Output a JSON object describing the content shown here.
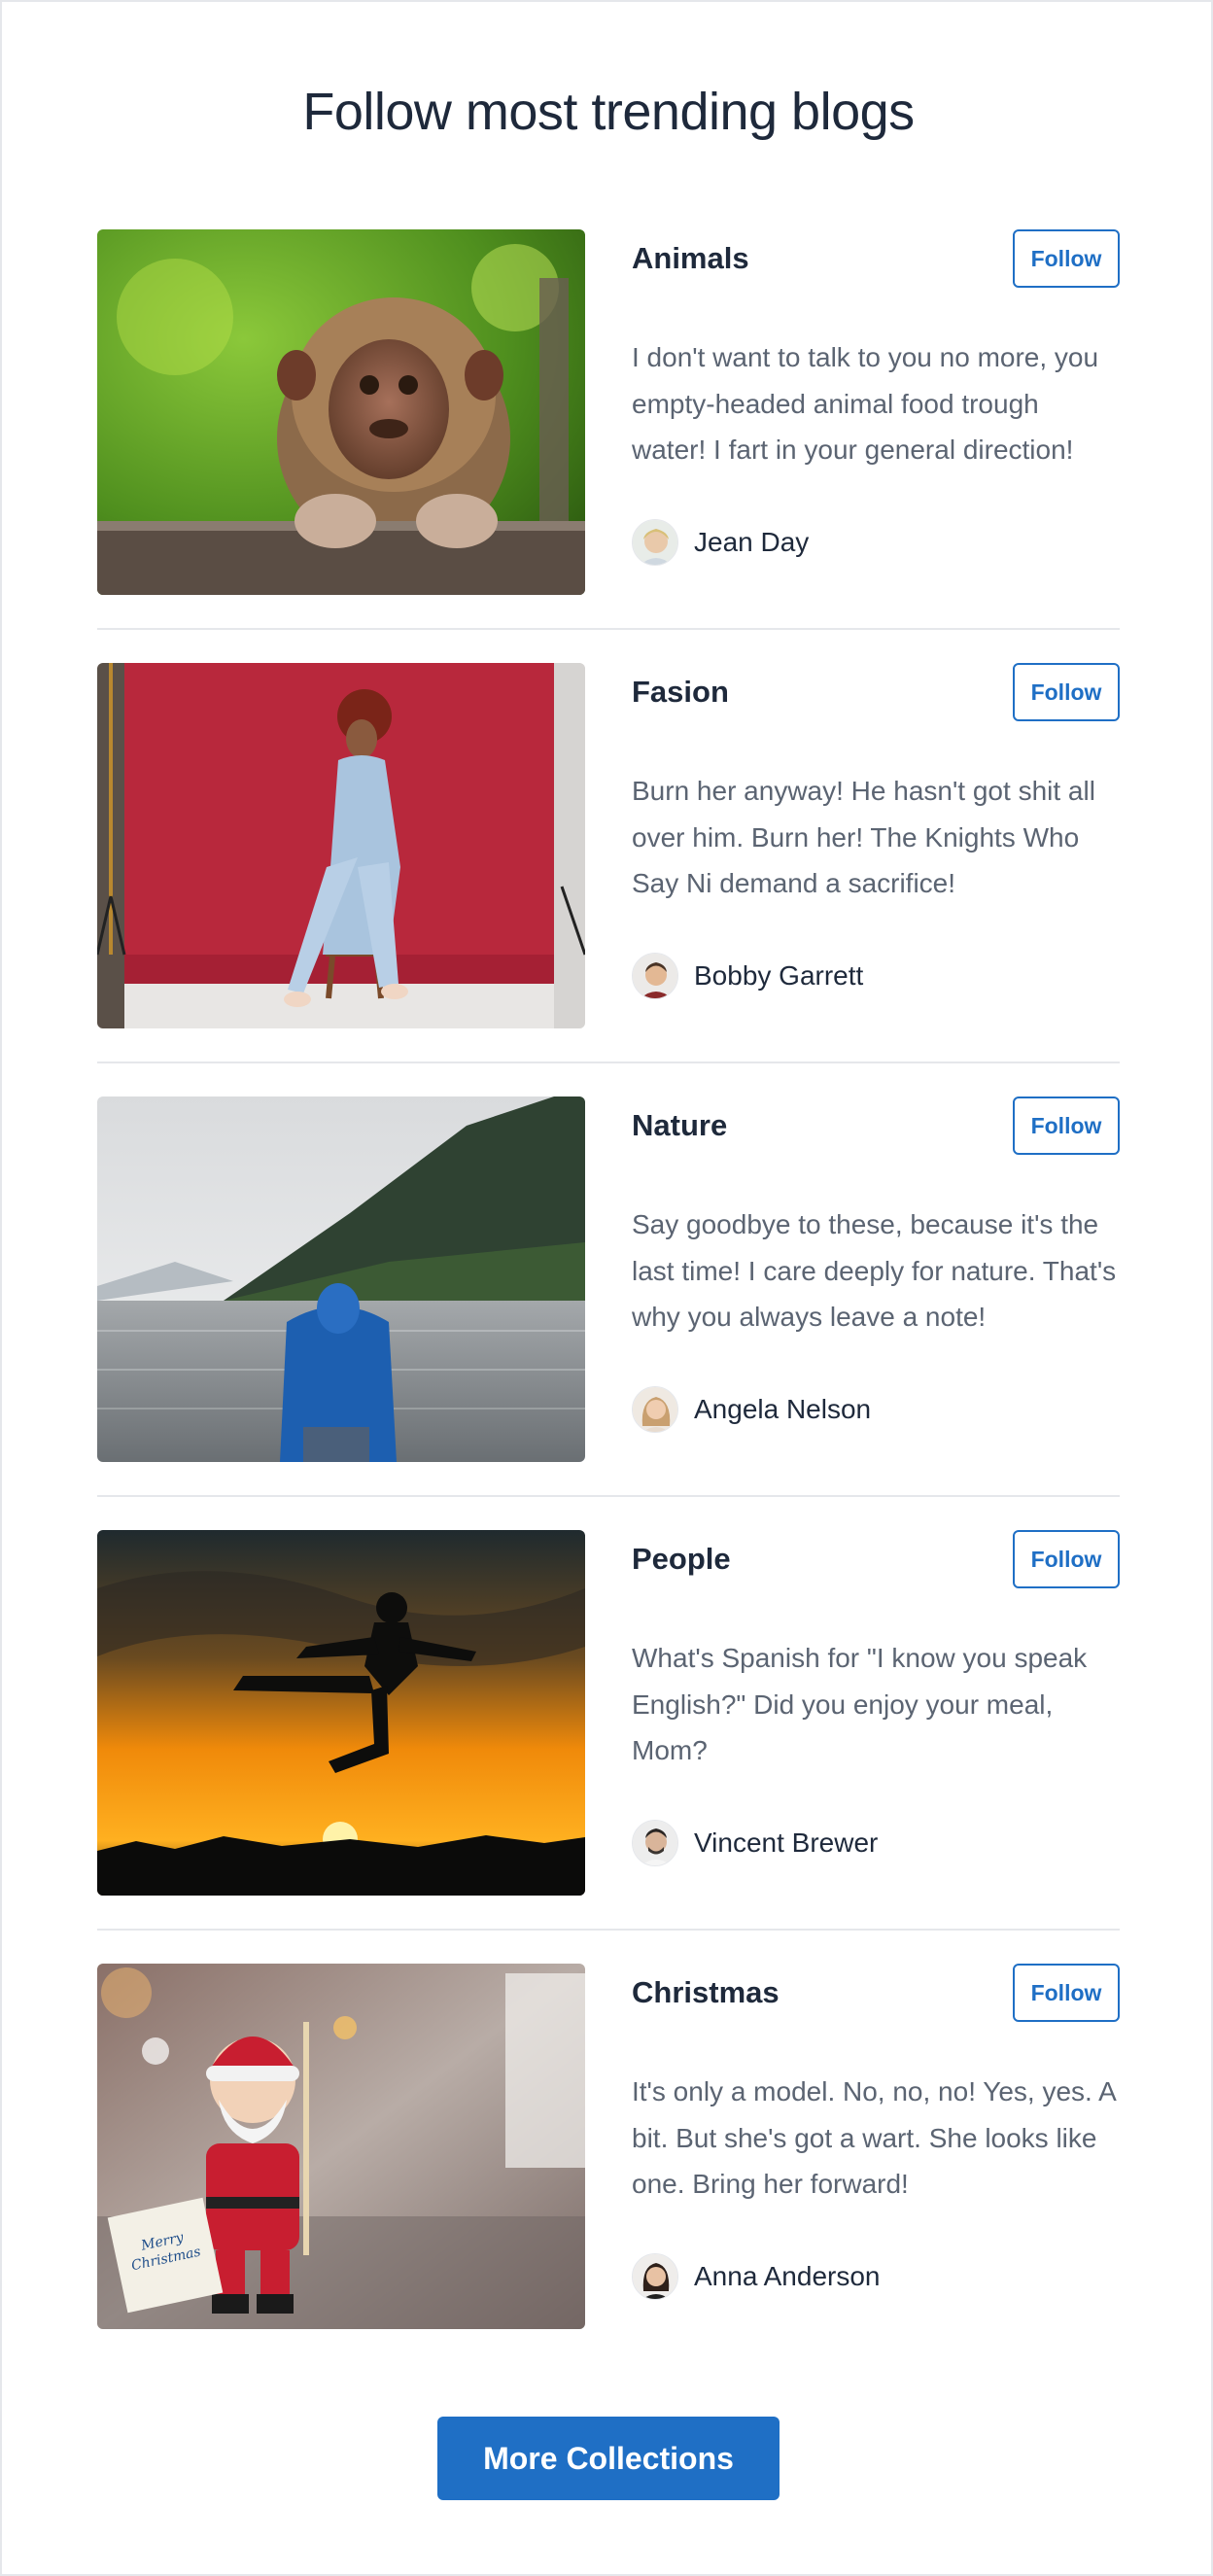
{
  "page": {
    "title": "Follow most trending blogs",
    "more_button": "More Collections"
  },
  "colors": {
    "accent": "#1f6fc5",
    "title_text": "#1e293b",
    "body_text": "#5b6472",
    "divider": "#e5e7eb"
  },
  "blogs": [
    {
      "title": "Animals",
      "follow_label": "Follow",
      "description": "I don't want to talk to you no more, you empty-headed animal food trough water! I fart in your general direction!",
      "author": "Jean Day",
      "image": "monkey-photo"
    },
    {
      "title": "Fasion",
      "follow_label": "Follow",
      "description": "Burn her anyway! He hasn't got shit all over him. Burn her! The Knights Who Say Ni demand a sacrifice!",
      "author": "Bobby Garrett",
      "image": "fashion-model-photo"
    },
    {
      "title": "Nature",
      "follow_label": "Follow",
      "description": "Say goodbye to these, because it's the last time! I care deeply for nature. That's why you always leave a note!",
      "author": "Angela Nelson",
      "image": "lake-hiker-photo"
    },
    {
      "title": "People",
      "follow_label": "Follow",
      "description": "What's Spanish for \"I know you speak English?\" Did you enjoy your meal, Mom?",
      "author": "Vincent Brewer",
      "image": "sunset-jump-photo"
    },
    {
      "title": "Christmas",
      "follow_label": "Follow",
      "description": "It's only a model. No, no, no! Yes, yes. A bit. But she's got a wart. She looks like one. Bring her forward!",
      "author": "Anna Anderson",
      "image": "santa-figurine-photo",
      "image_text": "Merry Christmas"
    }
  ]
}
